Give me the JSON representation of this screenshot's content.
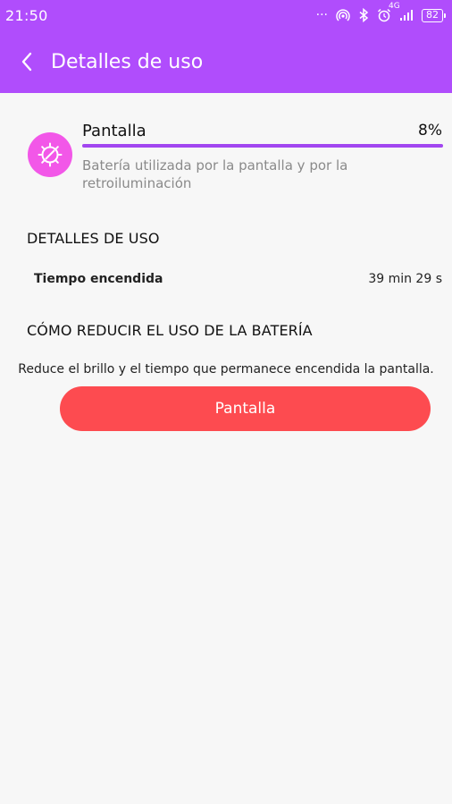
{
  "status_bar": {
    "time": "21:50",
    "overflow": "···",
    "network": "4G",
    "battery": "82",
    "icons": [
      "hotspot-icon",
      "bluetooth-icon",
      "alarm-icon",
      "signal-icon",
      "battery-icon"
    ]
  },
  "app_bar": {
    "title": "Detalles de uso",
    "back_icon": "chevron-left-icon",
    "color": "#b04dfc"
  },
  "usage": {
    "name": "Pantalla",
    "percent_label": "8%",
    "percent_value": 100,
    "description": "Batería utilizada por la pantalla y por la retroiluminación",
    "icon": "screen-brightness-icon",
    "icon_color": "#f257e8",
    "bar_color": "#a246f0"
  },
  "details": {
    "heading": "DETALLES DE USO",
    "rows": [
      {
        "label": "Tiempo encendida",
        "value": "39 min 29 s"
      }
    ]
  },
  "reduce": {
    "heading": "CÓMO REDUCIR EL USO DE LA BATERÍA",
    "tip": "Reduce el brillo y el tiempo que permanece encendida la pantalla.",
    "button_label": "Pantalla",
    "button_color": "#fd4b50"
  }
}
